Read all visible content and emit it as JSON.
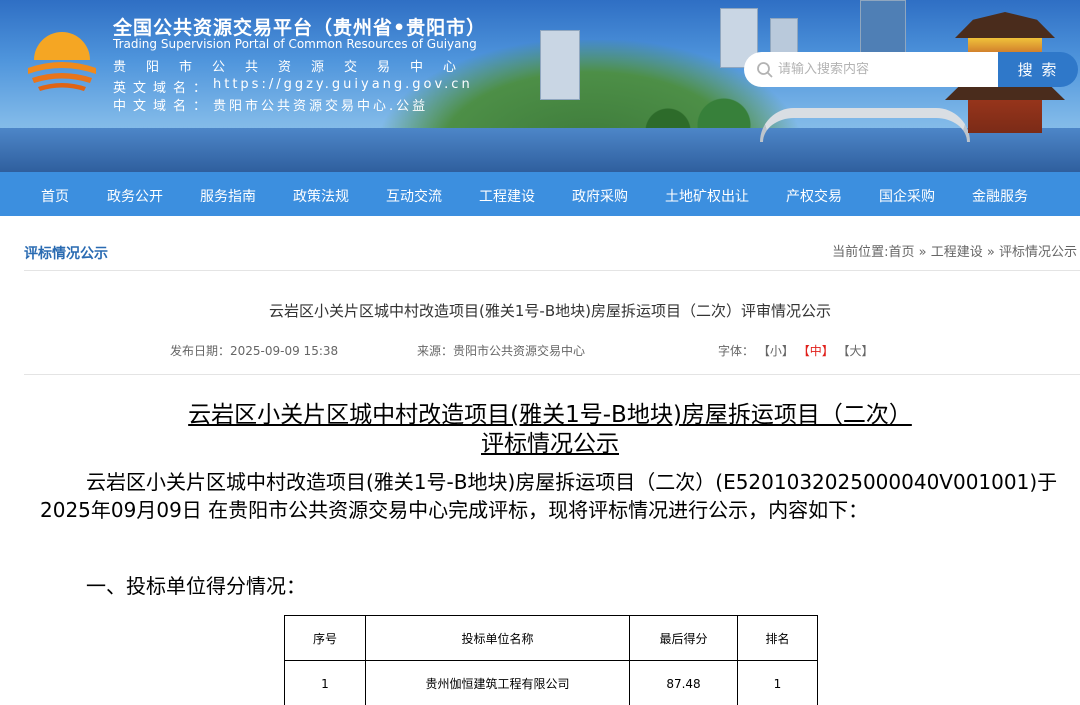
{
  "header": {
    "site_title": "全国公共资源交易平台（贵州省•贵阳市）",
    "site_subtitle": "Trading Supervision Portal of Common Resources of Guiyang",
    "info": [
      {
        "label": "",
        "value": "贵阳市公共资源交易中心"
      },
      {
        "label": "英文域名：",
        "value": "https://ggzy.guiyang.gov.cn"
      },
      {
        "label": "中文域名：",
        "value": "贵阳市公共资源交易中心.公益"
      }
    ],
    "search": {
      "placeholder": "请输入搜索内容",
      "button": "搜 索"
    }
  },
  "nav": {
    "items": [
      "首页",
      "政务公开",
      "服务指南",
      "政策法规",
      "互动交流",
      "工程建设",
      "政府采购",
      "土地矿权出让",
      "产权交易",
      "国企采购",
      "金融服务"
    ]
  },
  "column": {
    "title": "评标情况公示",
    "breadcrumb": {
      "prefix": "当前位置:",
      "items": [
        "首页",
        "工程建设",
        "评标情况公示"
      ],
      "separator": " » "
    }
  },
  "article": {
    "title": "云岩区小关片区城中村改造项目(雅关1号-B地块)房屋拆运项目（二次）评审情况公示",
    "publish_date": "发布日期：2025-09-09 15:38",
    "source": "来源：贵阳市公共资源交易中心",
    "font_size": {
      "label": "字体：",
      "small": "【小】",
      "medium": "【中】",
      "large": "【大】"
    }
  },
  "document": {
    "title_line1": "云岩区小关片区城中村改造项目(雅关1号-B地块)房屋拆运项目（二次）",
    "title_line2": "评标情况公示",
    "paragraph": "云岩区小关片区城中村改造项目(雅关1号-B地块)房屋拆运项目（二次）(E5201032025000040V001001)于2025年09月09日 在贵阳市公共资源交易中心完成评标，现将评标情况进行公示，内容如下：",
    "section1": "一、投标单位得分情况：",
    "table": {
      "headers": [
        "序号",
        "投标单位名称",
        "最后得分",
        "排名"
      ],
      "rows": [
        [
          "1",
          "贵州伽恒建筑工程有限公司",
          "87.48",
          "1"
        ]
      ]
    }
  },
  "colors": {
    "nav_bg": "#3c8fdf",
    "accent": "#2a6bb2",
    "highlight_red": "#e0201b"
  }
}
